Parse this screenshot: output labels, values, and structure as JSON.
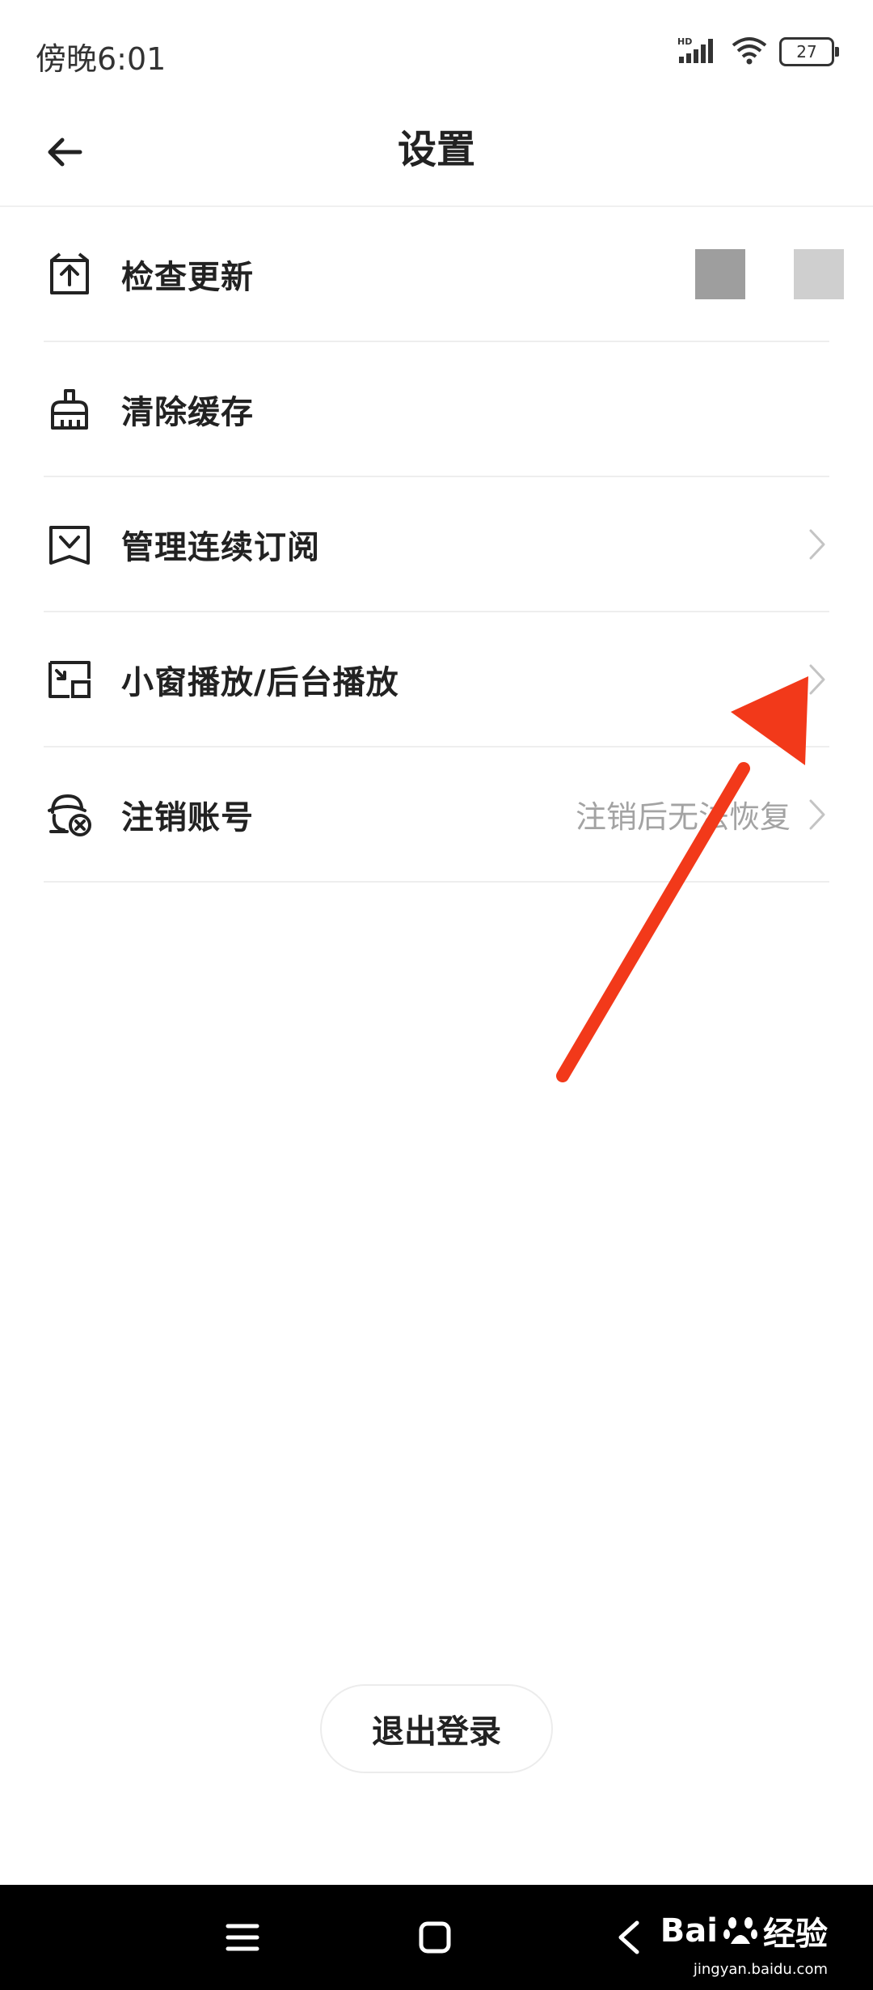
{
  "status_bar": {
    "time": "傍晚6:01",
    "network_badge": "HD",
    "battery_level": "27",
    "icons": [
      "signal-icon",
      "wifi-icon",
      "battery-icon"
    ]
  },
  "header": {
    "title": "设置",
    "back_icon": "arrow-left-icon"
  },
  "settings": {
    "items": [
      {
        "label": "检查更新",
        "icon": "upload-box-icon",
        "value": "",
        "chevron": false
      },
      {
        "label": "清除缓存",
        "icon": "broom-icon",
        "value": "",
        "chevron": false
      },
      {
        "label": "管理连续订阅",
        "icon": "subscription-icon",
        "value": "",
        "chevron": true
      },
      {
        "label": "小窗播放/后台播放",
        "icon": "picture-in-picture-icon",
        "value": "",
        "chevron": true
      },
      {
        "label": "注销账号",
        "icon": "account-cancel-icon",
        "value": "注销后无法恢复",
        "chevron": true
      }
    ]
  },
  "logout": {
    "label": "退出登录"
  },
  "nav_bar": {
    "buttons": [
      "menu-icon",
      "home-icon",
      "back-icon"
    ],
    "watermark_text": "Bai",
    "watermark_suffix": "经验",
    "watermark_url": "jingyan.baidu.com"
  },
  "colors": {
    "annotation_arrow": "#f2391a",
    "text_primary": "#222222",
    "text_secondary": "#a3a3a3",
    "divider": "#eeeeee"
  }
}
